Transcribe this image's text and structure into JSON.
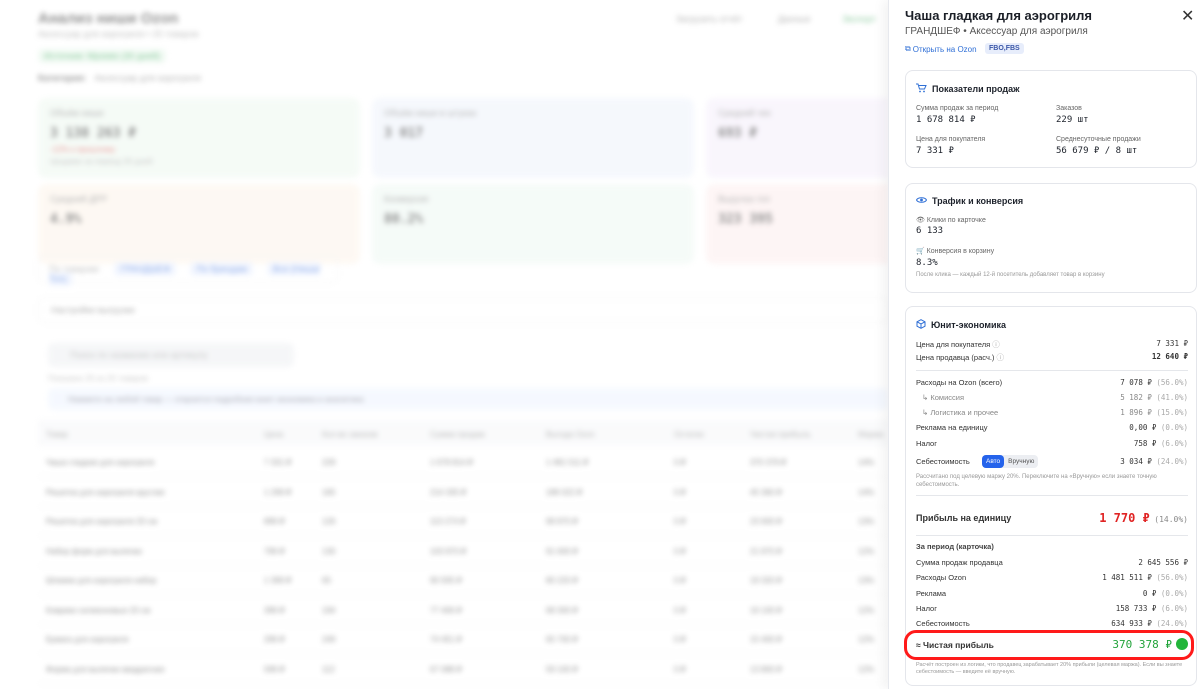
{
  "bg": {
    "title": "Анализ ниши Ozon",
    "subtitle": "Аксессуар для аэрогриля • 25 товаров",
    "badge": "Источник: Mpstats (30 дней)",
    "category_label": "Категория:",
    "category_value": "Аксессуар для аэрогриля",
    "header_right": [
      "Загрузить отчёт",
      "Данные",
      "Экспорт"
    ],
    "cards": [
      {
        "title": "Объём ниши",
        "value": "3 138 263 ₽",
        "red": "-12% к прошлому",
        "sub": "продажи за период 30 дней"
      },
      {
        "title": "Объём ниши в штуках",
        "value": "3 017",
        "red": "",
        "sub": ""
      },
      {
        "title": "Средний чек",
        "value": "693 ₽",
        "red": "",
        "sub": ""
      },
      {
        "title": "Средний ДРР",
        "value": "4.9%",
        "red": "",
        "sub": ""
      },
      {
        "title": "Конверсия",
        "value": "80.2%",
        "red": "",
        "sub": ""
      },
      {
        "title": "Выручка топ",
        "value": "323 395",
        "red": "",
        "sub": ""
      }
    ],
    "tabs": [
      "По товарам:",
      "ГРАНДШЕФ",
      "По брендам",
      "Все (Ниша/Топ)"
    ],
    "filter": "Настройки выгрузки",
    "search_placeholder": "Поиск по названию или артикулу",
    "found": "Показано 25 из 25 товаров",
    "note": "Нажмите на любой товар — откроется подробная юнит-экономика и аналитика",
    "columns": [
      "Товар",
      "Цена",
      "Кол-во заказов",
      "Сумма продаж",
      "Выгода Ozon",
      "Остатки",
      "Чистая прибыль",
      "Маржа"
    ],
    "rows": [
      [
        "Чаша гладкая для аэрогриля",
        "7 331 ₽",
        "229",
        "1 678 814 ₽",
        "1 481 511 ₽",
        "0 ₽",
        "370 378 ₽",
        "14%"
      ],
      [
        "Решетка для аэрогриля круглая",
        "1 299 ₽",
        "165",
        "214 335 ₽",
        "189 022 ₽",
        "0 ₽",
        "45 360 ₽",
        "14%"
      ],
      [
        "Решетка для аэрогриля 20 см",
        "899 ₽",
        "126",
        "113 274 ₽",
        "99 870 ₽",
        "0 ₽",
        "23 600 ₽",
        "13%"
      ],
      [
        "Набор форм для выпечки",
        "799 ₽",
        "130",
        "103 870 ₽",
        "91 600 ₽",
        "0 ₽",
        "21 870 ₽",
        "12%"
      ],
      [
        "Шпажки для аэрогриля набор",
        "1 399 ₽",
        "65",
        "90 935 ₽",
        "80 220 ₽",
        "0 ₽",
        "19 320 ₽",
        "13%"
      ],
      [
        "Коврики силиконовые 20 см",
        "399 ₽",
        "194",
        "77 406 ₽",
        "68 300 ₽",
        "0 ₽",
        "16 100 ₽",
        "12%"
      ],
      [
        "Бумага для аэрогриля",
        "299 ₽",
        "249",
        "74 451 ₽",
        "65 700 ₽",
        "0 ₽",
        "15 400 ₽",
        "12%"
      ],
      [
        "Форма для выпечки квадратная",
        "599 ₽",
        "112",
        "67 088 ₽",
        "59 100 ₽",
        "0 ₽",
        "13 800 ₽",
        "12%"
      ]
    ]
  },
  "drawer": {
    "title": "Чаша гладкая для аэрогриля",
    "subtitle": "ГРАНДШЕФ • Аксессуар для аэрогриля",
    "link": "Открыть на Ozon",
    "badge": "FBO,FBS",
    "sales": {
      "title": "Показатели продаж",
      "sum_label": "Сумма продаж за период",
      "sum": "1 678 814 ₽",
      "orders_label": "Заказов",
      "orders": "229 шт",
      "price_label": "Цена для покупателя",
      "price": "7 331 ₽",
      "avg_label": "Среднесуточные продажи",
      "avg": "56 679 ₽ / 8 шт"
    },
    "traffic": {
      "title": "Трафик и конверсия",
      "clicks_label": "👁 Клики по карточке",
      "clicks": "6 133",
      "conv_label": "🛒 Конверсия в корзину",
      "conv": "8.3%",
      "hint": "После клика — каждый 12-й посетитель добавляет товар в корзину"
    },
    "unit": {
      "title": "Юнит-экономика",
      "buyer_price_label": "Цена для покупателя",
      "buyer_price": "7 331 ₽",
      "seller_price_label": "Цена продавца (расч.)",
      "seller_price": "12 640 ₽",
      "ozon_total_label": "Расходы на Ozon (всего)",
      "ozon_total": "7 078 ₽",
      "ozon_total_pct": "(56.0%)",
      "commission_label": "↳ Комиссия",
      "commission": "5 182 ₽",
      "commission_pct": "(41.0%)",
      "logistics_label": "↳ Логистика и прочее",
      "logistics": "1 896 ₽",
      "logistics_pct": "(15.0%)",
      "ads_label": "Реклама на единицу",
      "ads": "0,00 ₽",
      "ads_pct": "(0.0%)",
      "tax_label": "Налог",
      "tax": "758 ₽",
      "tax_pct": "(6.0%)",
      "cost_label": "Себестоимость",
      "cost_auto": "Авто",
      "cost_manual": "Вручную",
      "cost": "3 034 ₽",
      "cost_pct": "(24.0%)",
      "cost_hint": "Рассчитано под целевую маржу 20%. Переключите на «Вручную» если знаете точную себестоимость.",
      "profit_label": "Прибыль на единицу",
      "profit": "1 770 ₽",
      "profit_pct": "(14.0%)",
      "period_label": "За период (карточка)",
      "p_sales_label": "Сумма продаж продавца",
      "p_sales": "2 645 556 ₽",
      "p_ozon_label": "Расходы Ozon",
      "p_ozon": "1 481 511 ₽",
      "p_ozon_pct": "(56.0%)",
      "p_ads_label": "Реклама",
      "p_ads": "0 ₽",
      "p_ads_pct": "(0.0%)",
      "p_tax_label": "Налог",
      "p_tax": "158 733 ₽",
      "p_tax_pct": "(6.0%)",
      "p_cost_label": "Себестоимость",
      "p_cost": "634 933 ₽",
      "p_cost_pct": "(24.0%)",
      "net_label": "≈ Чистая прибыль",
      "net": "370 378 ₽",
      "footer": "Расчёт построен из логики, что продавец зарабатывает 20% прибыли (целевая маржа). Если вы знаете себестоимость — введите её вручную."
    }
  }
}
